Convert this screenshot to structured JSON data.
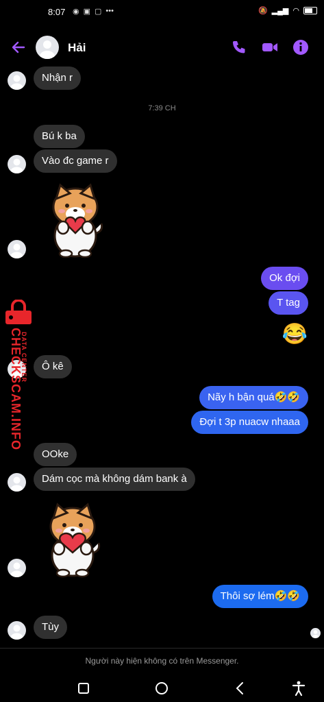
{
  "status": {
    "time": "8:07",
    "left_icons": [
      "messenger-icon",
      "notification-icon",
      "screenshot-icon",
      "more-icon"
    ],
    "right_icons": [
      "mute-icon",
      "signal-icon",
      "wifi-icon",
      "battery-icon"
    ]
  },
  "header": {
    "contact_name": "Hải",
    "icons": [
      "back-arrow-icon",
      "phone-icon",
      "video-icon",
      "info-icon"
    ],
    "accent": "#a259ff"
  },
  "messages": [
    {
      "from": "them",
      "text": "Nhận r"
    },
    {
      "from": "system",
      "text": "7:39 CH"
    },
    {
      "from": "them",
      "text": "Bú k ba"
    },
    {
      "from": "them",
      "text": "Vào đc game r"
    },
    {
      "from": "them",
      "type": "sticker",
      "sticker": "shiba-heart-sticker"
    },
    {
      "from": "me",
      "text": "Ok đợi"
    },
    {
      "from": "me",
      "text": "T tag"
    },
    {
      "from": "me",
      "type": "emoji",
      "text": "😂"
    },
    {
      "from": "them",
      "text": "Ô kê"
    },
    {
      "from": "me",
      "text": "Nãy h bận quá🤣🤣"
    },
    {
      "from": "me",
      "text": "Đợi t 3p nuacw nhaaa"
    },
    {
      "from": "them",
      "text": "OOke"
    },
    {
      "from": "them",
      "text": "Dám cọc mà không dám bank à"
    },
    {
      "from": "them",
      "type": "sticker",
      "sticker": "shiba-heart-sticker"
    },
    {
      "from": "me",
      "text": "Thôi sợ lém🤣🤣"
    },
    {
      "from": "them",
      "text": "Tùy"
    }
  ],
  "watermark": {
    "main": "CHECKSCAM.INFO",
    "sub": "DATA CENTER"
  },
  "footer_note": "Người này hiện không có trên Messenger.",
  "navbar": [
    "recent-apps-icon",
    "home-icon",
    "back-icon",
    "accessibility-icon"
  ],
  "colors": {
    "bubble_in": "#303030",
    "bubble_out_top": "#7a4cf0",
    "bubble_out_bottom": "#1c6bf0",
    "watermark": "#e8262b"
  }
}
